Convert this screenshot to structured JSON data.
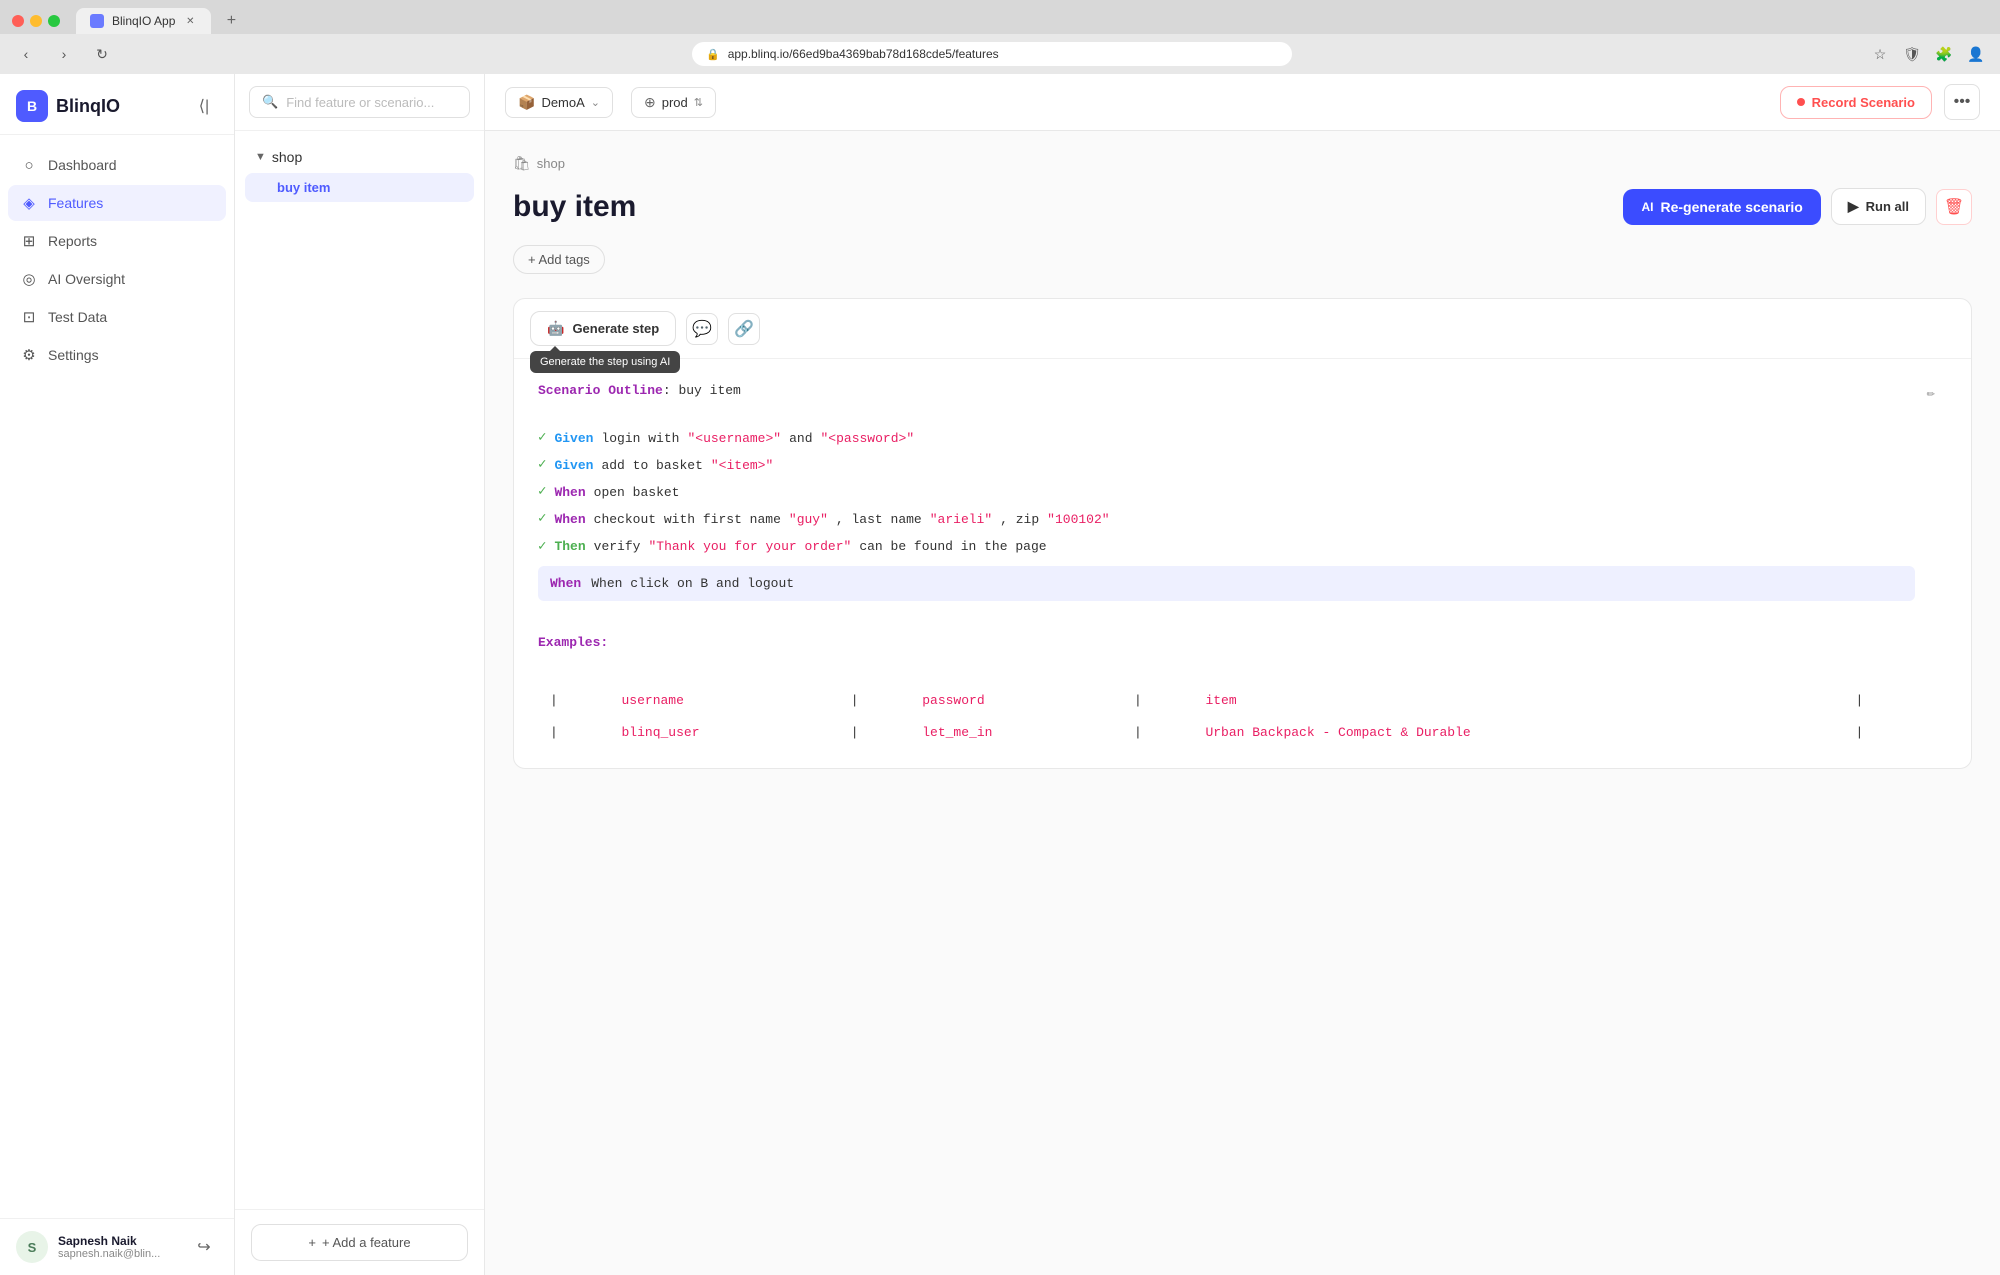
{
  "browser": {
    "tab_label": "BlinqIO App",
    "url": "app.blinq.io/66ed9ba4369bab78d168cde5/features",
    "new_tab_label": "+"
  },
  "sidebar": {
    "logo_text": "BlinqIO",
    "collapse_tooltip": "Collapse sidebar",
    "nav_items": [
      {
        "id": "dashboard",
        "label": "Dashboard",
        "icon": "○"
      },
      {
        "id": "features",
        "label": "Features",
        "icon": "◈",
        "active": true
      },
      {
        "id": "reports",
        "label": "Reports",
        "icon": "⊞"
      },
      {
        "id": "ai-oversight",
        "label": "AI Oversight",
        "icon": "◎"
      },
      {
        "id": "test-data",
        "label": "Test Data",
        "icon": "⊡"
      },
      {
        "id": "settings",
        "label": "Settings",
        "icon": "⚙"
      }
    ],
    "user": {
      "name": "Sapnesh Naik",
      "email": "sapnesh.naik@blin...",
      "initials": "S"
    }
  },
  "feature_panel": {
    "search_placeholder": "Find feature or scenario...",
    "tree": {
      "group": "shop",
      "items": [
        {
          "label": "buy item",
          "active": true
        }
      ]
    },
    "add_feature_label": "+ Add a feature"
  },
  "topbar": {
    "app_selector": "DemoA",
    "env_selector": "prod",
    "record_label": "Record Scenario",
    "more_icon": "•••"
  },
  "content": {
    "breadcrumb_icon": "🛍",
    "breadcrumb_text": "shop",
    "title": "buy item",
    "btn_regenerate": "Re-generate scenario",
    "btn_run_all": "Run all",
    "add_tags_label": "+ Add tags"
  },
  "toolbar": {
    "generate_step_label": "Generate step",
    "tooltip": "Generate the step using AI"
  },
  "scenario": {
    "outline_label": "Scenario Outline",
    "outline_title": "buy item",
    "steps": [
      {
        "keyword": "Given",
        "text": "login with ",
        "params": [
          "\"<username>\"",
          "\"<password>\""
        ],
        "between": " and "
      },
      {
        "keyword": "Given",
        "text": "add to basket ",
        "params": [
          "\"<item>\""
        ]
      },
      {
        "keyword": "When",
        "text": "open basket",
        "params": []
      },
      {
        "keyword": "When",
        "text": "checkout with first name ",
        "params": [
          "\"guy\"",
          "\"arieli\"",
          "\"100102\""
        ],
        "between_parts": [
          ", last name ",
          ", zip "
        ]
      },
      {
        "keyword": "Then",
        "text": "verify ",
        "params": [
          "\"Thank you for your order\""
        ],
        "suffix": " can be found in the page"
      }
    ],
    "highlighted_step": "When click on B and logout",
    "examples_label": "Examples:",
    "table_headers": [
      "username",
      "password",
      "item"
    ],
    "table_rows": [
      [
        "blinq_user",
        "let_me_in",
        "Urban Backpack - Compact & Durable"
      ]
    ]
  }
}
